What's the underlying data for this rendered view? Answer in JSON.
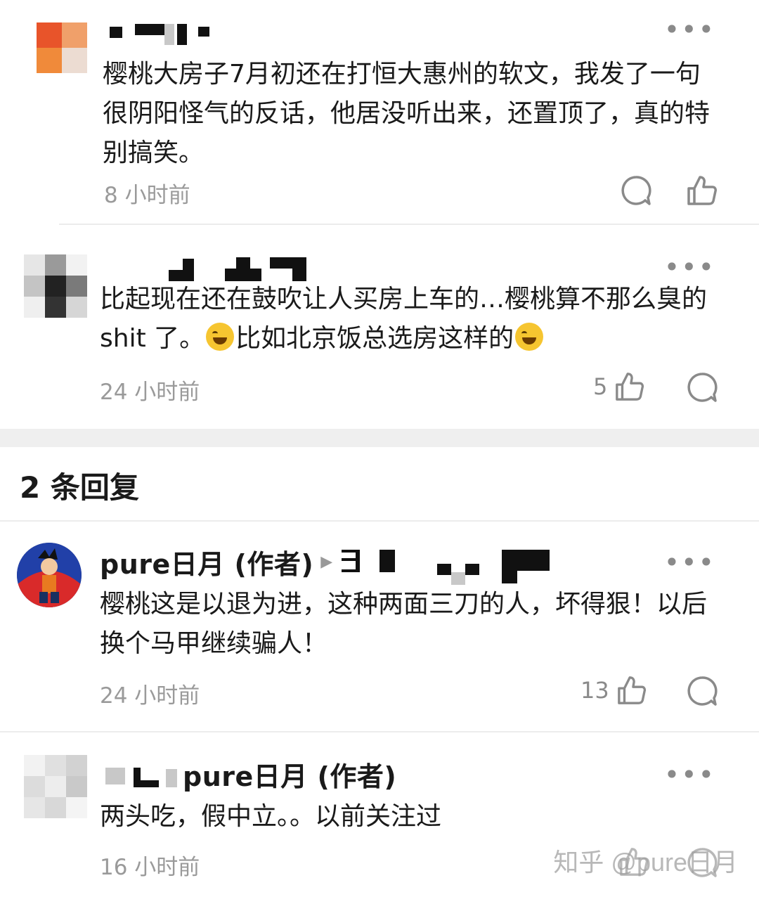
{
  "comments": [
    {
      "text": "樱桃大房子7月初还在打恒大惠州的软文，我发了一句很阴阳怪气的反话，他居没听出来，还置顶了，真的特别搞笑。",
      "time": "8 小时前"
    },
    {
      "text_part1": "比起现在还在鼓吹让人买房上车的…樱桃算不那么臭的 shit 了。",
      "text_part2": "比如北京饭总选房这样的",
      "time": "24 小时前",
      "likes": "5"
    }
  ],
  "replies_section": {
    "title": "2 条回复"
  },
  "replies": [
    {
      "author": "pure日月 (作者)",
      "text": "樱桃这是以退为进，这种两面三刀的人，坏得狠！以后换个马甲继续骗人！",
      "time": "24 小时前",
      "likes": "13"
    },
    {
      "reply_to": "pure日月 (作者)",
      "text": "两头吃，假中立。。以前关注过",
      "time": "16 小时前"
    }
  ],
  "watermark": "知乎 @pure日月",
  "icons": {
    "more": "more-dots-icon",
    "comment": "comment-bubble-icon",
    "like": "thumbs-up-icon",
    "emoji": "rofl-emoji-icon",
    "reply_arrow": "reply-arrow-icon"
  },
  "colors": {
    "text": "#1a1a1a",
    "meta": "#9a9a9a",
    "divider": "#ececec"
  }
}
